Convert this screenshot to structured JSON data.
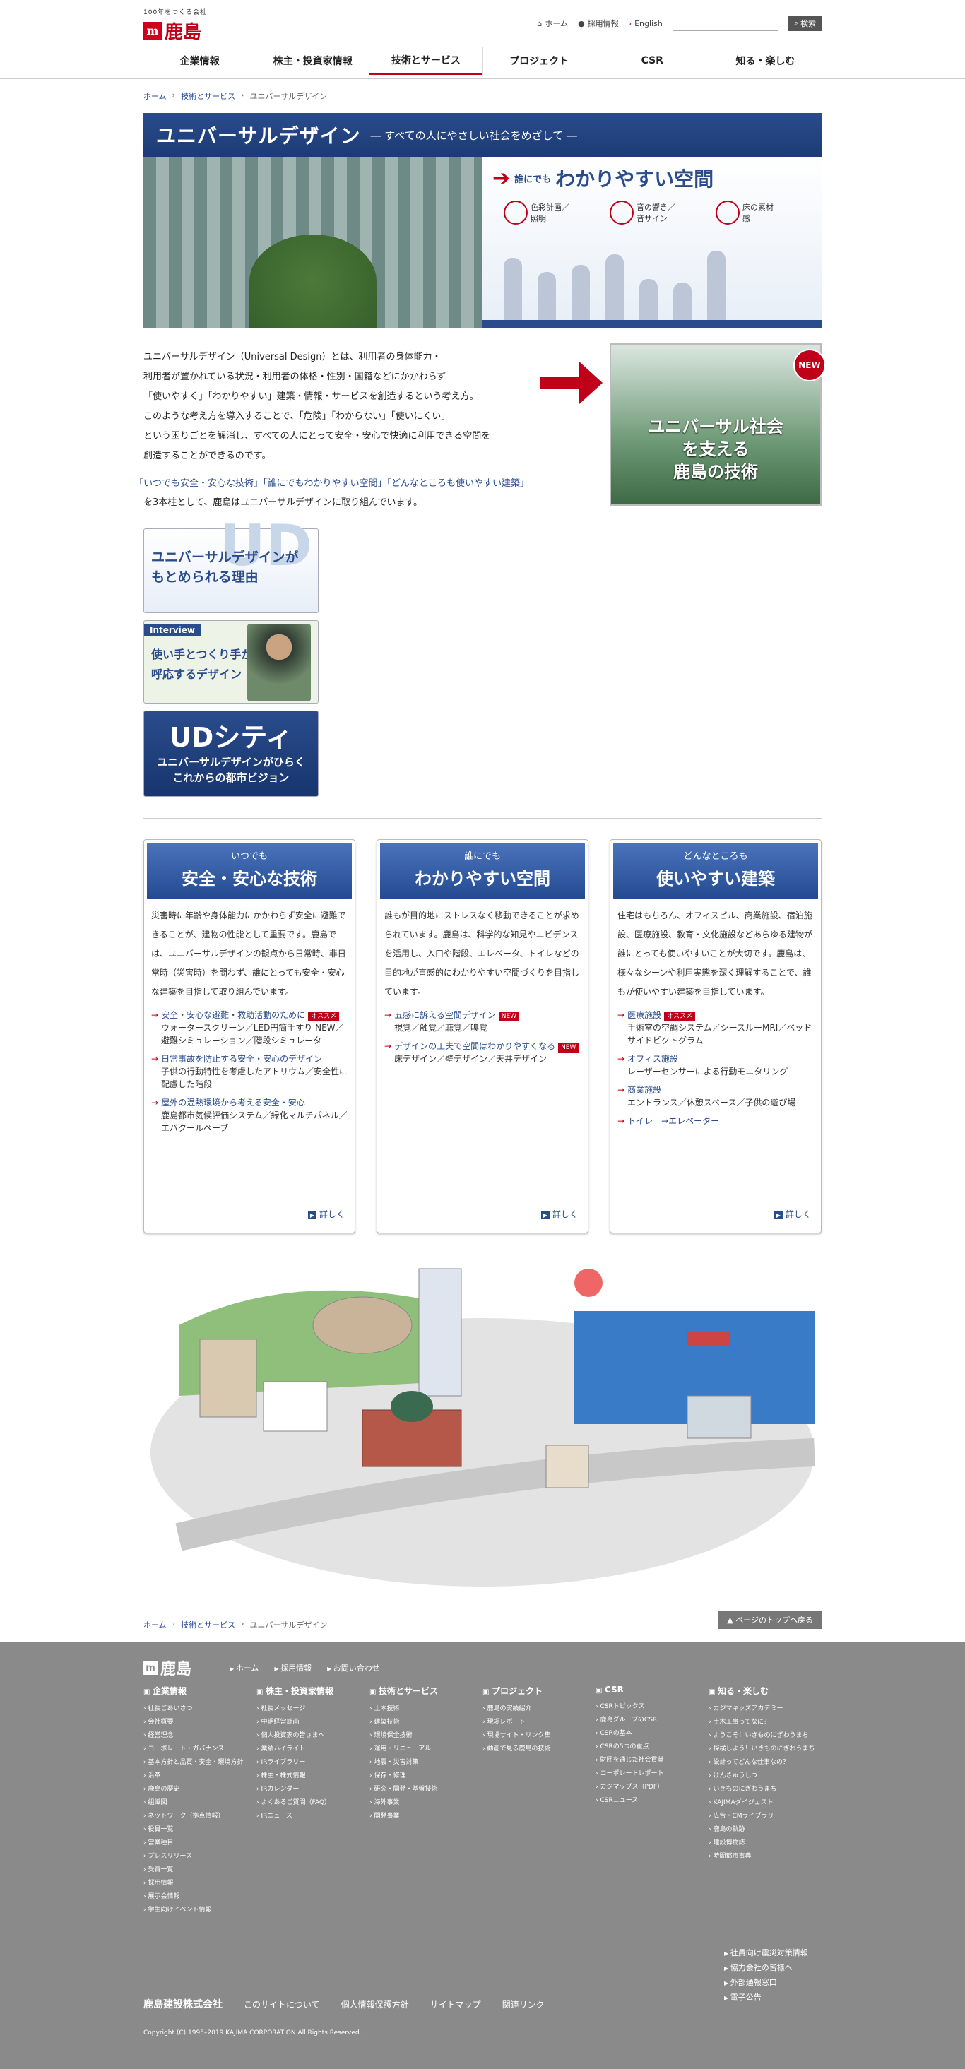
{
  "header": {
    "logo_tag": "100年をつくる会社",
    "logo_mark": "m",
    "logo_name": "鹿島",
    "util": {
      "home": "ホーム",
      "recruit": "採用情報",
      "english": "English",
      "search_btn": "検索"
    },
    "nav": [
      "企業情報",
      "株主・投資家情報",
      "技術とサービス",
      "プロジェクト",
      "CSR",
      "知る・楽しむ"
    ]
  },
  "breadcrumb": {
    "home": "ホーム",
    "tech": "技術とサービス",
    "current": "ユニバーサルデザイン"
  },
  "hero": {
    "title": "ユニバーサルデザイン",
    "subtitle": "― すべての人にやさしい社会をめざして ―",
    "h1": "誰にでも",
    "h2": "わかりやすい空間",
    "icons": [
      {
        "label": "色彩計画／照明"
      },
      {
        "label": "音の響き／音サイン"
      },
      {
        "label": "床の素材感"
      }
    ]
  },
  "intro": {
    "lines": [
      "ユニバーサルデザイン（Universal Design）とは、利用者の身体能力・",
      "利用者が置かれている状況・利用者の体格・性別・国籍などにかかわらず",
      "「使いやすく」「わかりやすい」建築・情報・サービスを創造するという考え方。",
      "このような考え方を導入することで、「危険」「わからない」「使いにくい」",
      "という困りごとを解消し、すべての人にとって安全・安心で快適に利用できる空間を",
      "創造することができるのです。"
    ],
    "highlight": "「いつでも安全・安心な技術」「誰にでもわかりやすい空間」「どんなところも使いやすい建築」",
    "highlight2": "を3本柱として、鹿島はユニバーサルデザインに取り組んでいます。"
  },
  "feature": {
    "text1": "ユニバーサル社会",
    "text2": "を支える",
    "text3": "鹿島の技術",
    "new": "NEW"
  },
  "banners": {
    "b1a": "ユニバーサルデザインが",
    "b1b": "もとめられる理由",
    "b1ud": "UD",
    "b2tag": "Interview",
    "b2a": "使い手とつくり手が",
    "b2b": "呼応するデザイン",
    "b3ud": "UDシティ",
    "b3a": "ユニバーサルデザインがひらく",
    "b3b": "これからの都市ビジョン"
  },
  "cards": [
    {
      "a": "いつでも",
      "b": "安全・安心な技術",
      "text": "災害時に年齢や身体能力にかかわらず安全に避難できることが、建物の性能として重要です。鹿島では、ユニバーサルデザインの観点から日常時、非日常時（災害時）を問わず、誰にとっても安全・安心な建築を目指して取り組んでいます。",
      "links": [
        {
          "l": "安全・安心な避難・救助活動のために",
          "badge": "オススメ",
          "sub": "ウォータースクリーン／LED円筒手すり NEW／避難シミュレーション／階段シミュレータ"
        },
        {
          "l": "日常事故を防止する安全・安心のデザイン",
          "badge": "",
          "sub": "子供の行動特性を考慮したアトリウム／安全性に配慮した階段"
        },
        {
          "l": "屋外の温熱環境から考える安全・安心",
          "badge": "",
          "sub": "鹿島都市気候評価システム／緑化マルチパネル／エバクールペーブ"
        }
      ],
      "more": "詳しく"
    },
    {
      "a": "誰にでも",
      "b": "わかりやすい空間",
      "text": "誰もが目的地にストレスなく移動できることが求められています。鹿島は、科学的な知見やエビデンスを活用し、入口や階段、エレベータ、トイレなどの目的地が直感的にわかりやすい空間づくりを目指しています。",
      "links": [
        {
          "l": "五感に訴える空間デザイン",
          "badge": "NEW",
          "sub": "視覚／触覚／聴覚／嗅覚"
        },
        {
          "l": "デザインの工夫で空間はわかりやすくなる",
          "badge": "NEW",
          "sub": "床デザイン／壁デザイン／天井デザイン"
        }
      ],
      "more": "詳しく"
    },
    {
      "a": "どんなところも",
      "b": "使いやすい建築",
      "text": "住宅はもちろん、オフィスビル、商業施設、宿泊施設、医療施設、教育・文化施設などあらゆる建物が誰にとっても使いやすいことが大切です。鹿島は、様々なシーンや利用実態を深く理解することで、誰もが使いやすい建築を目指しています。",
      "links": [
        {
          "l": "医療施設",
          "badge": "オススメ",
          "sub": "手術室の空調システム／シースルーMRI／ベッドサイドピクトグラム"
        },
        {
          "l": "オフィス施設",
          "badge": "",
          "sub": "レーザーセンサーによる行動モニタリング"
        },
        {
          "l": "商業施設",
          "badge": "",
          "sub": "エントランス／休憩スペース／子供の遊び場"
        },
        {
          "l": "トイレ　→エレベーター",
          "badge": "",
          "sub": ""
        }
      ],
      "more": "詳しく"
    }
  ],
  "totop": "ページのトップへ戻る",
  "footer": {
    "logo": "鹿島",
    "top_links": [
      "ホーム",
      "採用情報",
      "お問い合わせ"
    ],
    "cols": [
      {
        "h": "企業情報",
        "items": [
          "社長ごあいさつ",
          "会社概要",
          "経営理念",
          "コーポレート・ガバナンス",
          "基本方針と品質・安全・環境方針",
          "沿革",
          "鹿島の歴史",
          "組織図",
          "ネットワーク（拠点情報）",
          "役員一覧",
          "営業種目",
          "プレスリリース",
          "受賞一覧",
          "採用情報",
          "展示会情報",
          "学生向けイベント情報"
        ]
      },
      {
        "h": "株主・投資家情報",
        "items": [
          "社長メッセージ",
          "中期経営計画",
          "個人投資家の皆さまへ",
          "業績ハイライト",
          "IRライブラリー",
          "株主・株式情報",
          "IRカレンダー",
          "よくあるご質問（FAQ）",
          "IRニュース"
        ]
      },
      {
        "h": "技術とサービス",
        "items": [
          "土木技術",
          "建築技術",
          "環境保全技術",
          "運用・リニューアル",
          "地震・災害対策",
          "保存・修理",
          "研究・開発・基盤技術",
          "海外事業",
          "開発事業"
        ]
      },
      {
        "h": "プロジェクト",
        "items": [
          "鹿島の実績紹介",
          "現場レポート",
          "現場サイト・リンク集",
          "動画で見る鹿島の技術"
        ]
      },
      {
        "h": "CSR",
        "items": [
          "CSRトピックス",
          "鹿島グループのCSR",
          "CSRの基本",
          "CSRの5つの重点",
          "財団を通じた社会貢献",
          "コーポレートレポート",
          "カジマップス（PDF）",
          "CSRニュース"
        ]
      },
      {
        "h": "知る・楽しむ",
        "items": [
          "カジマキッズアカデミー",
          "土木工事ってなに？",
          "ようこそ！いきものにぎわうまち",
          "探検しよう！いきものにぎわうまち",
          "設計ってどんな仕事なの？",
          "けんきゅうしつ",
          "いきものにぎわうまち",
          "KAJIMAダイジェスト",
          "広告・CMライブラリ",
          "鹿島の軌跡",
          "建設博物誌",
          "時間都市事典"
        ]
      }
    ],
    "extra": [
      "社員向け震災対策情報",
      "協力会社の皆様へ",
      "外部通報窓口",
      "電子公告"
    ],
    "company": "鹿島建設株式会社",
    "bottom": [
      "このサイトについて",
      "個人情報保護方針",
      "サイトマップ",
      "関連リンク"
    ],
    "copyright": "Copyright (C) 1995–2019 KAJIMA CORPORATION All Rights Reserved."
  }
}
